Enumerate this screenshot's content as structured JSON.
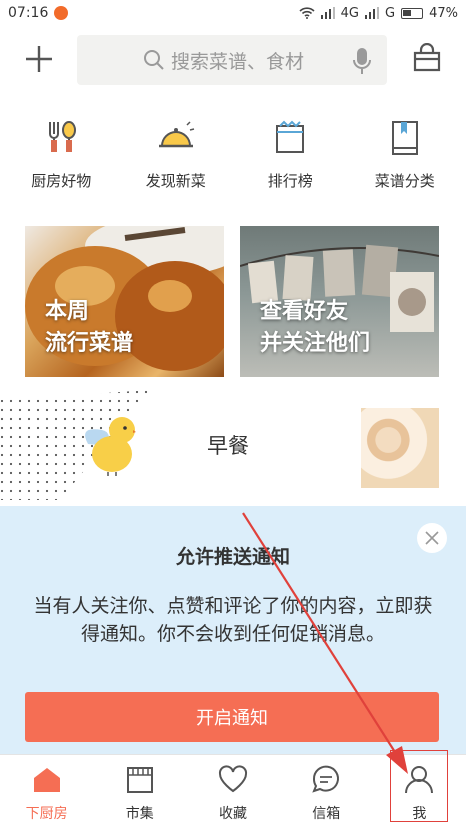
{
  "status_bar": {
    "time": "07:16",
    "network": "4G",
    "carrier": "G",
    "battery": "47%"
  },
  "header": {
    "search_placeholder": "搜索菜谱、食材"
  },
  "categories": [
    {
      "label": "厨房好物",
      "icon": "kitchen-tools-icon"
    },
    {
      "label": "发现新菜",
      "icon": "cloche-icon"
    },
    {
      "label": "排行榜",
      "icon": "ranking-icon"
    },
    {
      "label": "菜谱分类",
      "icon": "recipe-book-icon"
    }
  ],
  "banners": [
    {
      "title_line1": "本周",
      "title_line2": "流行菜谱"
    },
    {
      "title_line1": "查看好友",
      "title_line2": "并关注他们"
    }
  ],
  "meal": {
    "label": "早餐"
  },
  "notification": {
    "title": "允许推送通知",
    "body": "当有人关注你、点赞和评论了你的内容，立即获得通知。你不会收到任何促销消息。",
    "button": "开启通知"
  },
  "bottom_nav": [
    {
      "label": "下厨房",
      "icon": "home-icon",
      "active": true
    },
    {
      "label": "市集",
      "icon": "market-icon",
      "active": false
    },
    {
      "label": "收藏",
      "icon": "heart-icon",
      "active": false
    },
    {
      "label": "信箱",
      "icon": "message-icon",
      "active": false
    },
    {
      "label": "我",
      "icon": "profile-icon",
      "active": false
    }
  ],
  "colors": {
    "accent": "#f56e54",
    "panel_bg": "#dceefa",
    "annotation": "#e0413b"
  }
}
